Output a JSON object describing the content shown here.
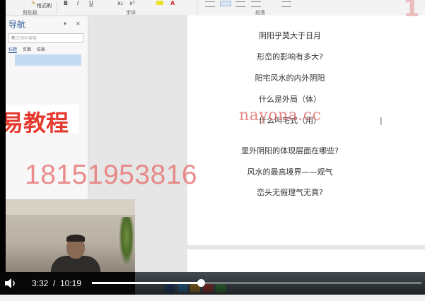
{
  "ribbon": {
    "groups": [
      "剪贴板",
      "字体",
      "段落"
    ],
    "format_painter": "格式刷",
    "tools": [
      "B",
      "I",
      "U",
      "x₂",
      "x²",
      "A"
    ]
  },
  "nav_pane": {
    "title": "导航",
    "search_placeholder": "搜文档中搜索",
    "tabs": [
      "标题",
      "页面",
      "结果"
    ]
  },
  "document": {
    "lines": [
      "阴阳乎莫大于日月",
      "形峦的影响有多大?",
      "阳宅风水的内外阴阳",
      "什么是外局（体）",
      "什么叫宅式（用）",
      "里外阴阳的体现层面在哪些?",
      "风水的最高境界——观气",
      "峦头无假理气无真?"
    ]
  },
  "overlays": {
    "title_partial": "易教程",
    "phone": "18151953816",
    "watermark": "nayona.cc",
    "corner_partial": "1"
  },
  "player": {
    "current_time": "3:32",
    "separator": "/",
    "duration": "10:19",
    "progress": 0.33
  }
}
